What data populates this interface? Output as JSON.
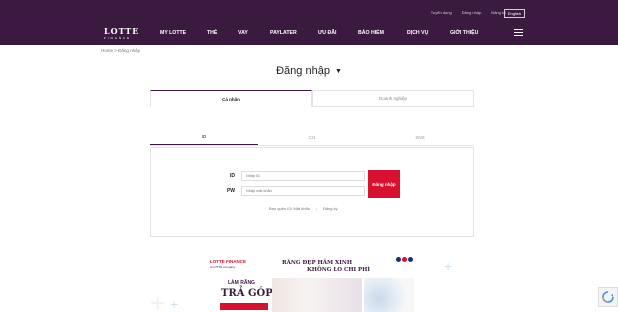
{
  "header": {
    "top_links": [
      "Tuyển dụng",
      "Đăng nhập",
      "Đăng ký"
    ],
    "language": "English",
    "logo_main": "LOTTE",
    "logo_sub": "FINANCE",
    "nav": [
      "MY LOTTE",
      "THẺ",
      "VAY",
      "PAYLATER",
      "ƯU ĐÃI",
      "BẢO HIỂM",
      "DỊCH VỤ",
      "GIỚI THIỆU"
    ]
  },
  "breadcrumb": "Home  >  Đăng nhập",
  "page_title": "Đăng nhập",
  "user_type_tabs": [
    "Cá nhân",
    "Doanh nghiệp"
  ],
  "method_tabs": [
    "ID",
    "CI1",
    "SNS"
  ],
  "form": {
    "id_label": "ID",
    "id_placeholder": "Nhập ID",
    "pw_label": "PW",
    "pw_placeholder": "Nhập mật khẩu",
    "login_button": "Đăng nhập",
    "forgot_link": "Bạn quên ID/ Mật khẩu",
    "separator": "|",
    "register_link": "Đăng ký"
  },
  "banner": {
    "brand": "LOTTE FINANCE",
    "brand_sub": "A LOTTE company",
    "headline_1": "RĂNG ĐẸP HÂM XINH",
    "headline_2": "KHÔNG LO CHI PHÍ",
    "lam_rang": "LÀM RĂNG",
    "tra_gop": "TRẢ GÓP"
  },
  "colors": {
    "header_bg": "#3b1a40",
    "accent_red": "#d7112e"
  }
}
